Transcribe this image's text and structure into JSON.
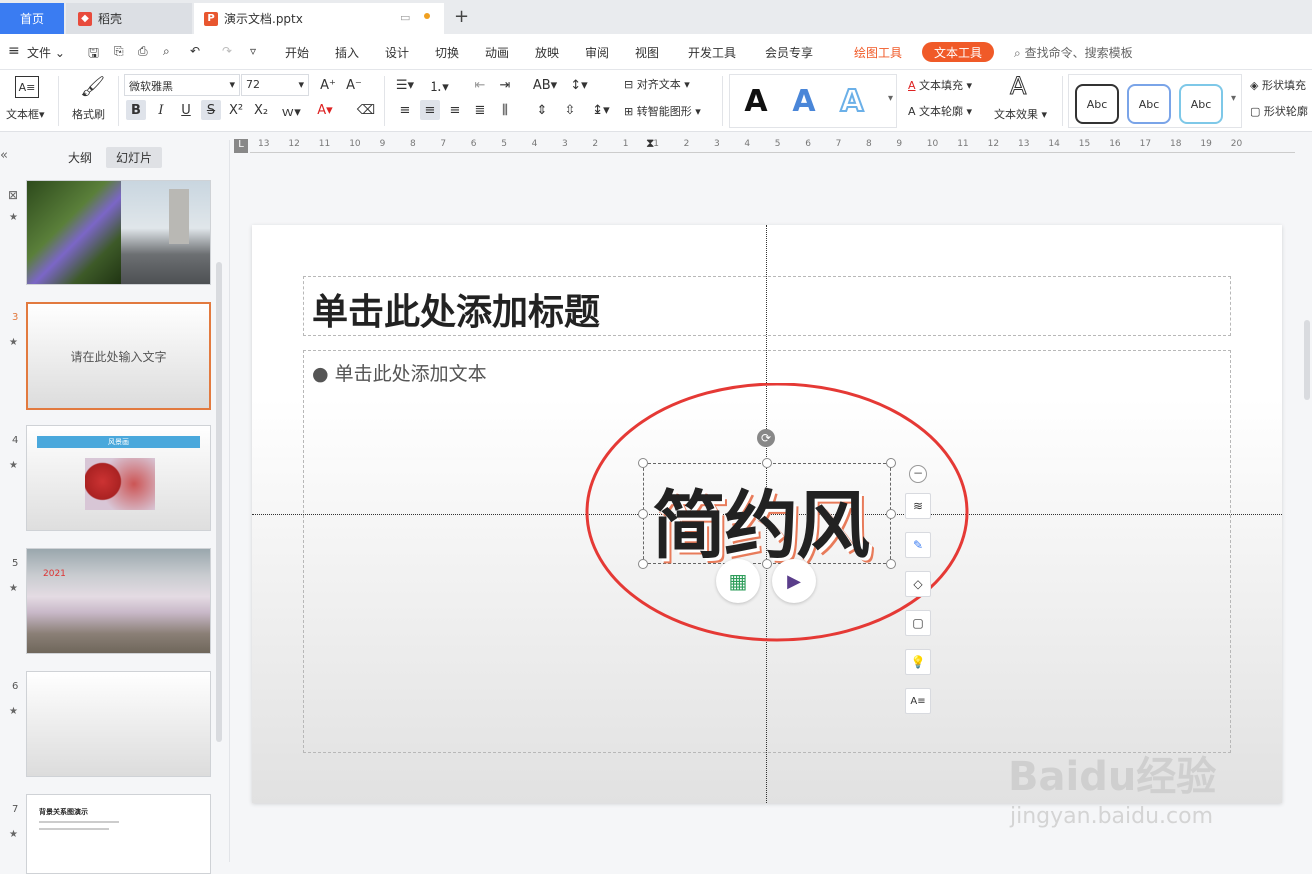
{
  "tabs": {
    "home": "首页",
    "daoke": "稻壳",
    "document": "演示文档.pptx"
  },
  "menu": {
    "file": "文件",
    "items": [
      "开始",
      "插入",
      "设计",
      "切换",
      "动画",
      "放映",
      "审阅",
      "视图",
      "开发工具",
      "会员专享"
    ],
    "drawing_tools": "绘图工具",
    "text_tools": "文本工具",
    "search_placeholder": "查找命令、搜索模板"
  },
  "ribbon": {
    "textbox": "文本框",
    "format_painter": "格式刷",
    "font_name": "微软雅黑",
    "font_size": "72",
    "align_text": "对齐文本",
    "smart_shape": "转智能图形",
    "text_fill": "文本填充",
    "text_outline": "文本轮廓",
    "text_effect": "文本效果",
    "abc_label": "Abc",
    "shape_fill": "形状填充",
    "shape_outline": "形状轮廓"
  },
  "sidebar": {
    "outline_tab": "大纲",
    "slides_tab": "幻灯片",
    "slide3_text": "请在此处输入文字",
    "slide4_title": "风景画",
    "slide5_year": "2021",
    "slide7_title": "背景关系图演示"
  },
  "slide_numbers": [
    "3",
    "4",
    "5",
    "6",
    "7"
  ],
  "slide": {
    "title_placeholder": "单击此处添加标题",
    "body_placeholder": "单击此处添加文本",
    "art_text": "简约风"
  },
  "ruler_labels": [
    "13",
    "12",
    "11",
    "10",
    "9",
    "8",
    "7",
    "6",
    "5",
    "4",
    "3",
    "2",
    "1",
    "1",
    "2",
    "3",
    "4",
    "5",
    "6",
    "7",
    "8",
    "9",
    "10",
    "11",
    "12",
    "13",
    "14",
    "15",
    "16",
    "17",
    "18",
    "19",
    "20"
  ],
  "watermark": {
    "brand": "Baidu经验",
    "url": "jingyan.baidu.com"
  },
  "colors": {
    "accent_blue": "#3a7cf2",
    "accent_orange": "#f05a28",
    "ellipse_red": "#e53935",
    "selected_thumb": "#e27a3f"
  }
}
